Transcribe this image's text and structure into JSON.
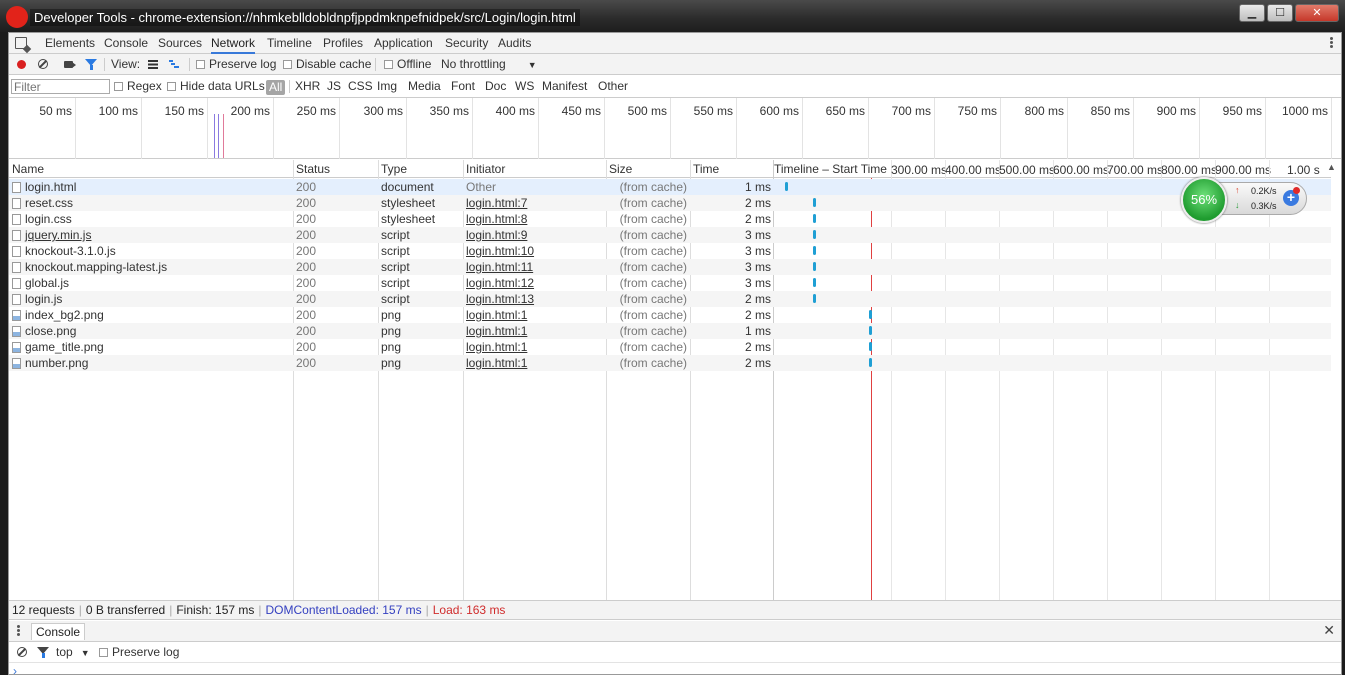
{
  "window": {
    "title": "Developer Tools - chrome-extension://nhmkeblldobldnpfjppdmknpefnidpek/src/Login/login.html",
    "min": "▁",
    "max": "☐",
    "close": "✕"
  },
  "main_tabs": [
    "Elements",
    "Console",
    "Sources",
    "Network",
    "Timeline",
    "Profiles",
    "Application",
    "Security",
    "Audits"
  ],
  "active_tab": "Network",
  "toolbar": {
    "view_label": "View:",
    "preserve_log": "Preserve log",
    "disable_cache": "Disable cache",
    "offline": "Offline",
    "throttling": "No throttling",
    "dropdown_arrow": "▼"
  },
  "filterbar": {
    "placeholder": "Filter",
    "regex": "Regex",
    "hide_data_urls": "Hide data URLs",
    "types": [
      "All",
      "XHR",
      "JS",
      "CSS",
      "Img",
      "Media",
      "Font",
      "Doc",
      "WS",
      "Manifest",
      "Other"
    ]
  },
  "overview": {
    "labels": [
      "50 ms",
      "100 ms",
      "150 ms",
      "200 ms",
      "250 ms",
      "300 ms",
      "350 ms",
      "400 ms",
      "450 ms",
      "500 ms",
      "550 ms",
      "600 ms",
      "650 ms",
      "700 ms",
      "750 ms",
      "800 ms",
      "850 ms",
      "900 ms",
      "950 ms",
      "1000 ms"
    ]
  },
  "table": {
    "headers": {
      "name": "Name",
      "status": "Status",
      "type": "Type",
      "initiator": "Initiator",
      "size": "Size",
      "time": "Time",
      "timeline": "Timeline – Start Time"
    },
    "waterfall_labels": [
      "300.00 ms",
      "400.00 ms",
      "500.00 ms",
      "600.00 ms",
      "700.00 ms",
      "800.00 ms",
      "900.00 ms",
      "1.00 s"
    ],
    "sort_arrow": "▲",
    "rows": [
      {
        "name": "login.html",
        "status": "200",
        "type": "document",
        "initiator": "Other",
        "size": "(from cache)",
        "time": "1 ms",
        "icon": "document-icon"
      },
      {
        "name": "reset.css",
        "status": "200",
        "type": "stylesheet",
        "initiator": "login.html:7",
        "size": "(from cache)",
        "time": "2 ms",
        "icon": "file-icon"
      },
      {
        "name": "login.css",
        "status": "200",
        "type": "stylesheet",
        "initiator": "login.html:8",
        "size": "(from cache)",
        "time": "2 ms",
        "icon": "file-icon"
      },
      {
        "name": "jquery.min.js",
        "status": "200",
        "type": "script",
        "initiator": "login.html:9",
        "size": "(from cache)",
        "time": "3 ms",
        "icon": "file-icon"
      },
      {
        "name": "knockout-3.1.0.js",
        "status": "200",
        "type": "script",
        "initiator": "login.html:10",
        "size": "(from cache)",
        "time": "3 ms",
        "icon": "file-icon"
      },
      {
        "name": "knockout.mapping-latest.js",
        "status": "200",
        "type": "script",
        "initiator": "login.html:11",
        "size": "(from cache)",
        "time": "3 ms",
        "icon": "file-icon"
      },
      {
        "name": "global.js",
        "status": "200",
        "type": "script",
        "initiator": "login.html:12",
        "size": "(from cache)",
        "time": "3 ms",
        "icon": "file-icon"
      },
      {
        "name": "login.js",
        "status": "200",
        "type": "script",
        "initiator": "login.html:13",
        "size": "(from cache)",
        "time": "2 ms",
        "icon": "file-icon"
      },
      {
        "name": "index_bg2.png",
        "status": "200",
        "type": "png",
        "initiator": "login.html:1",
        "size": "(from cache)",
        "time": "2 ms",
        "icon": "image-icon"
      },
      {
        "name": "close.png",
        "status": "200",
        "type": "png",
        "initiator": "login.html:1",
        "size": "(from cache)",
        "time": "1 ms",
        "icon": "image-icon"
      },
      {
        "name": "game_title.png",
        "status": "200",
        "type": "png",
        "initiator": "login.html:1",
        "size": "(from cache)",
        "time": "2 ms",
        "icon": "image-icon"
      },
      {
        "name": "number.png",
        "status": "200",
        "type": "png",
        "initiator": "login.html:1",
        "size": "(from cache)",
        "time": "2 ms",
        "icon": "image-icon"
      }
    ]
  },
  "status_bar": {
    "requests": "12 requests",
    "transferred": "0 B transferred",
    "finish": "Finish: 157 ms",
    "dcl": "DOMContentLoaded: 157 ms",
    "load": "Load: 163 ms"
  },
  "drawer": {
    "tab": "Console",
    "close": "✕",
    "context": "top",
    "dropdown_arrow": "▼",
    "preserve_log": "Preserve log",
    "prompt": "›"
  },
  "widget": {
    "percent": "56%",
    "up_speed": "0.2K/s",
    "down_speed": "0.3K/s",
    "up_arrow": "↑",
    "down_arrow": "↓",
    "plus": "+"
  },
  "colors": {
    "accent": "#3879d9",
    "record": "#d92020",
    "waterfall_bar": "#1f9fd4",
    "load_line": "#e04040",
    "dcl_text": "#3440c0"
  }
}
